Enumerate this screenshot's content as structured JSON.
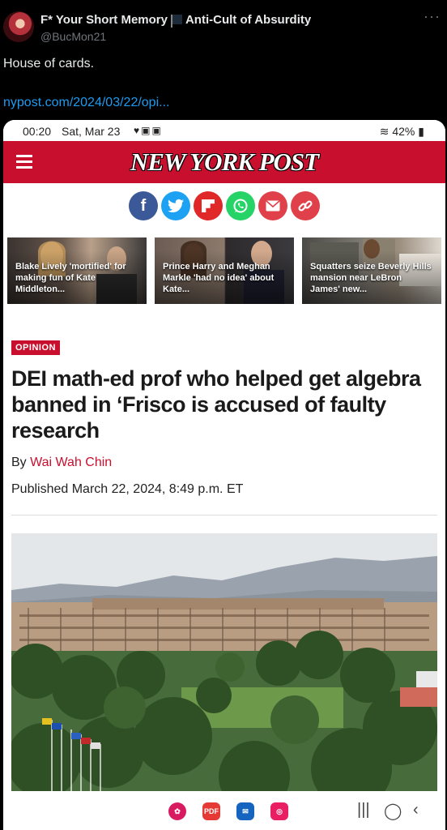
{
  "tweet": {
    "author_name": "F* Your Short Memory",
    "author_suffix": "Anti-Cult of Absurdity",
    "handle": "@BucMon21",
    "more": "···",
    "text": "House of cards.",
    "link": "nypost.com/2024/03/22/opi..."
  },
  "status_bar": {
    "time": "00:20",
    "date": "Sat, Mar 23",
    "battery": "42%"
  },
  "site": {
    "logo": "NEW YORK POST"
  },
  "share_icons": [
    {
      "icon": "facebook-icon",
      "glyph": "f",
      "color": "#3b5998"
    },
    {
      "icon": "twitter-icon",
      "glyph": "t",
      "color": "#1da1f2"
    },
    {
      "icon": "flipboard-icon",
      "glyph": "F",
      "color": "#e12828"
    },
    {
      "icon": "whatsapp-icon",
      "glyph": "w",
      "color": "#25d366"
    },
    {
      "icon": "email-icon",
      "glyph": "✉",
      "color": "#e0404a"
    },
    {
      "icon": "link-icon",
      "glyph": "⛓",
      "color": "#e0404a"
    }
  ],
  "stories": [
    {
      "title": "Blake Lively 'mortified' for making fun of Kate Middleton..."
    },
    {
      "title": "Prince Harry and Meghan Markle 'had no idea' about Kate..."
    },
    {
      "title": "Squatters seize Beverly Hills mansion near LeBron James' new..."
    }
  ],
  "article": {
    "section": "OPINION",
    "headline": "DEI math-ed prof who helped get algebra banned in ‘Frisco is accused of faulty research",
    "by_prefix": "By ",
    "author": "Wai Wah Chin",
    "published": "Published March 22, 2024, 8:49 p.m. ET"
  },
  "colors": {
    "brand_red": "#c8102e",
    "link_blue": "#1d9bf0"
  }
}
